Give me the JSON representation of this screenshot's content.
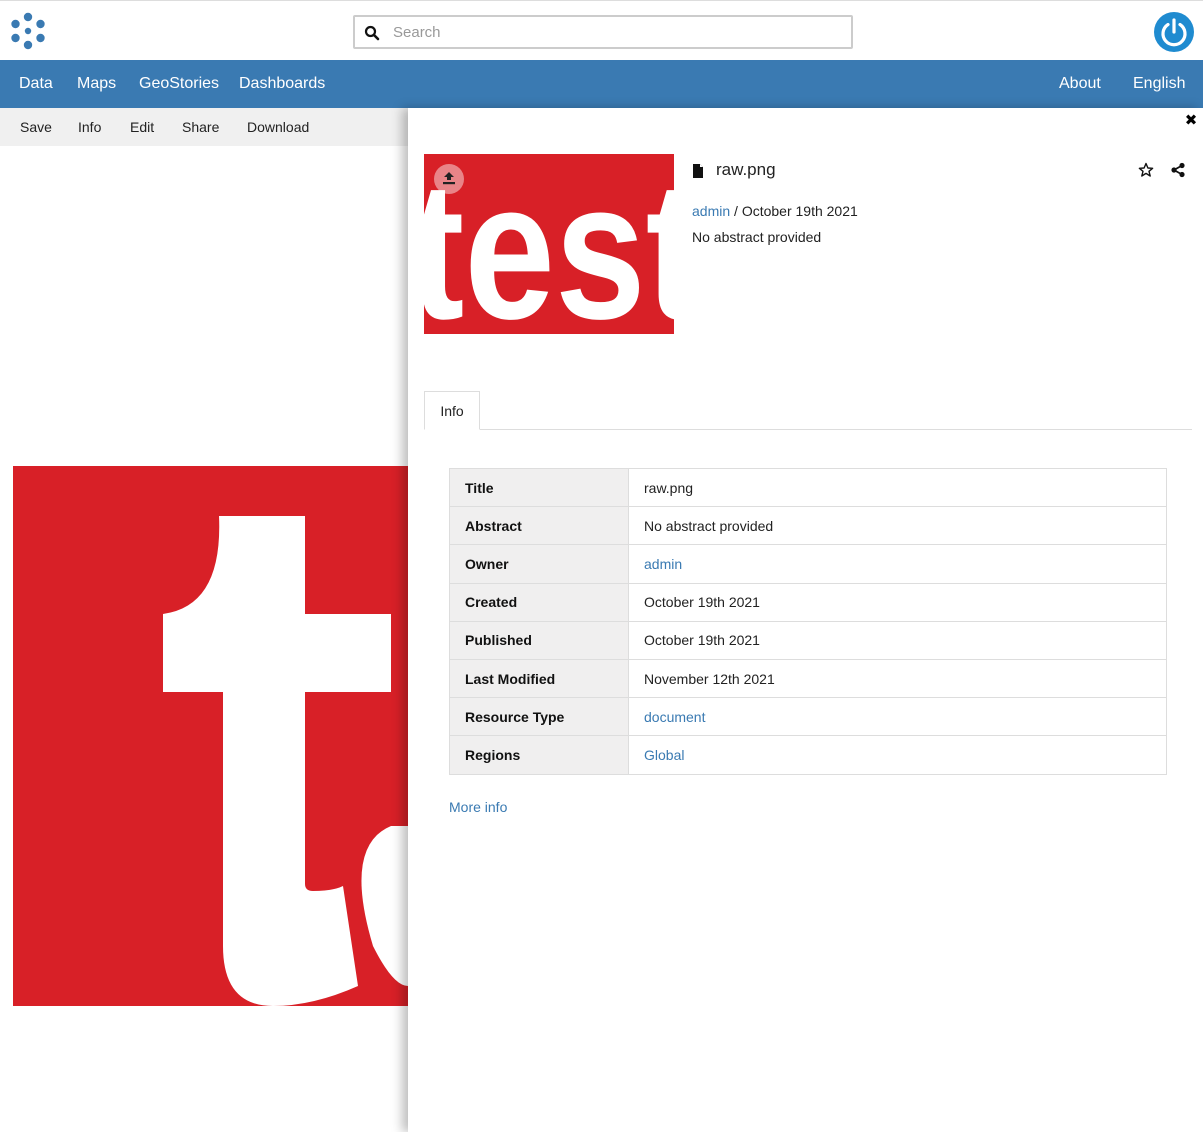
{
  "header": {
    "search_placeholder": "Search"
  },
  "nav": {
    "left": [
      "Data",
      "Maps",
      "GeoStories",
      "Dashboards"
    ],
    "right": [
      "About",
      "English"
    ]
  },
  "toolbar": [
    "Save",
    "Info",
    "Edit",
    "Share",
    "Download"
  ],
  "colors": {
    "nav_bg": "#3a7ab2",
    "user_button": "#1f8bd0",
    "preview_red": "#d82027",
    "link": "#3a7ab2"
  },
  "panel": {
    "title": "raw.png",
    "owner": "admin",
    "separator": "/",
    "date": "October 19th 2021",
    "abstract": "No abstract provided",
    "thumbnail_text": "test",
    "tab": "Info",
    "more_info": "More info",
    "rows": [
      {
        "key": "Title",
        "value": "raw.png",
        "link": false
      },
      {
        "key": "Abstract",
        "value": "No abstract provided",
        "link": false
      },
      {
        "key": "Owner",
        "value": "admin",
        "link": true
      },
      {
        "key": "Created",
        "value": "October 19th 2021",
        "link": false
      },
      {
        "key": "Published",
        "value": "October 19th 2021",
        "link": false
      },
      {
        "key": "Last Modified",
        "value": "November 12th 2021",
        "link": false
      },
      {
        "key": "Resource Type",
        "value": "document",
        "link": true
      },
      {
        "key": "Regions",
        "value": "Global",
        "link": true
      }
    ]
  },
  "icons": [
    "geonode-logo-icon",
    "search-icon",
    "user-power-icon",
    "close-icon",
    "upload-icon",
    "file-icon",
    "star-icon",
    "share-icon"
  ]
}
